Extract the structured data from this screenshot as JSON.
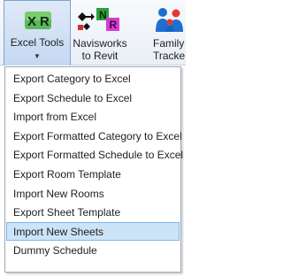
{
  "ribbon": {
    "excel_tools": {
      "icon_text": "X R",
      "label": "Excel Tools"
    },
    "navisworks": {
      "icon_n": "N",
      "icon_r": "R",
      "label_line1": "Navisworks",
      "label_line2": "to Revit"
    },
    "family_tracker": {
      "label_line1": "Family",
      "label_line2": "Tracke"
    }
  },
  "menu": {
    "items": [
      "Export Category to Excel",
      "Export Schedule to Excel",
      "Import from Excel",
      "Export Formatted Category to Excel",
      "Export Formatted Schedule to Excel",
      "Export Room Template",
      "Import New Rooms",
      "Export Sheet Template",
      "Import New Sheets",
      "Dummy Schedule"
    ],
    "highlighted_item": "Import New Sheets"
  },
  "colors": {
    "xr_icon_green": "#43a047",
    "n_icon_green": "#2e9e3e",
    "r_icon_magenta": "#d63bd6",
    "hover_background": "#cce4f7",
    "hover_border": "#7eb4ea"
  }
}
